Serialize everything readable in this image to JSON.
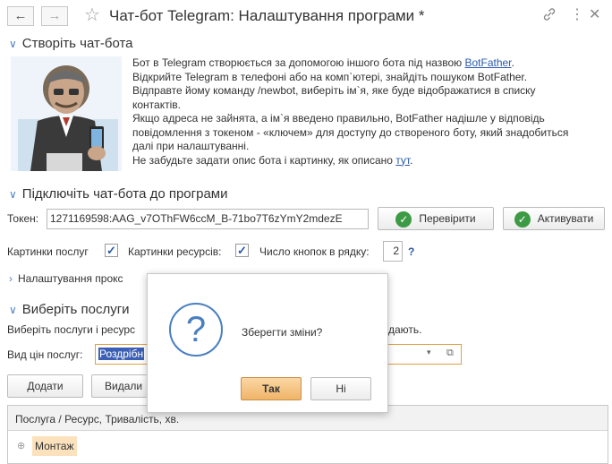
{
  "window": {
    "title": "Чат-бот Telegram: Налаштування програми *",
    "back_icon": "arrow-left-icon",
    "forward_icon": "arrow-right-icon",
    "favorite_icon": "star-icon",
    "link_icon": "link-icon",
    "menu_icon": "more-vertical-icon",
    "close_icon": "close-icon"
  },
  "section1": {
    "title": "Створіть чат-бота",
    "line1_pre": "Бот в Telegram створюється за допомогою іншого бота під назвою ",
    "line1_link": "BotFather",
    "line1_post": ".",
    "line2": "Відкрийте Telegram в телефоні або на комп`ютері, знайдіть пошуком BotFather.",
    "line3": "Відправте йому команду /newbot, виберіть ім`я, яке буде відображатися в списку",
    "line4": "контактів.",
    "line5": "Якщо адреса не зайнята, а ім`я введено правильно, BotFather надішле у відповідь",
    "line6": "повідомлення з токеном - «ключем» для доступу до створеного боту, який знадобиться",
    "line7": "далі при налаштуванні.",
    "line8_pre": "Не забудьте задати опис бота і картинку, як описано ",
    "line8_link": "тут",
    "line8_post": "."
  },
  "section2": {
    "title": "Підключіть чат-бота до програми",
    "token_label": "Токен:",
    "token_value": "1271169598:AAG_v7OThFW6ccM_B-71bo7T6zYmY2mdezE",
    "verify_button": "Перевірити",
    "activate_button": "Активувати",
    "service_images_label": "Картинки послуг",
    "resource_images_label": "Картинки ресурсів:",
    "buttons_per_row_label": "Число кнопок в рядку:",
    "buttons_per_row_value": "2",
    "help_mark": "?",
    "proxy_settings": "Налаштування прокс"
  },
  "section3": {
    "title": "Виберіть послуги",
    "description_pre": "Виберіть послуги і ресурс",
    "description_post": "дають.",
    "price_type_label": "Вид цін послуг:",
    "price_type_value": "Роздрібн",
    "add_button": "Додати",
    "remove_button": "Видали",
    "table_header": "Послуга / Ресурс, Тривалість, хв.",
    "rows": [
      {
        "label": "Монтаж",
        "expand": "⊕"
      }
    ]
  },
  "dialog": {
    "message": "Зберегти зміни?",
    "yes_button": "Так",
    "no_button": "Ні",
    "icon": "question-icon"
  },
  "colors": {
    "accent": "#4a7fbf",
    "link": "#2a5aa8",
    "ok_green": "#3d9a45",
    "selection": "#3b5fb5",
    "default_button": "#f5c280"
  }
}
